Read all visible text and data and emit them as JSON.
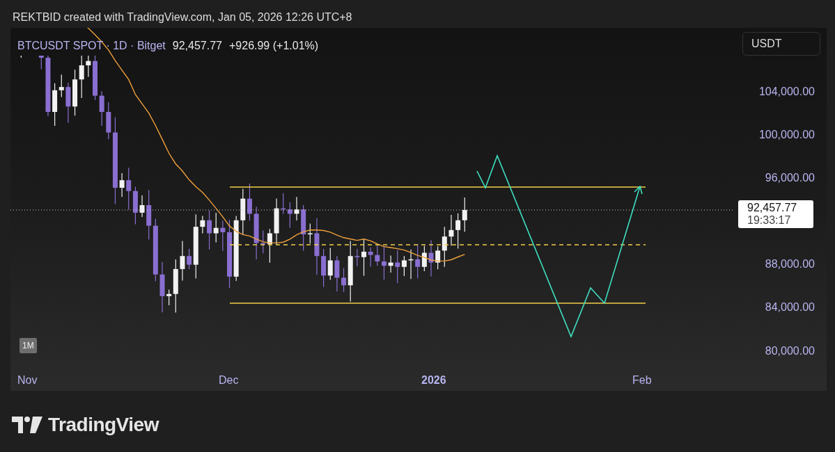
{
  "attribution": "REKTBID created with TradingView.com, Jan 05, 2026 12:26 UTC+8",
  "legend": {
    "symbol": "BTCUSDT SPOT · 1D · Bitget",
    "price": "92,457.77",
    "change": "+926.99 (+1.01%)"
  },
  "currency_button": "USDT",
  "price_axis": [
    "104,000.00",
    "100,000.00",
    "96,000.00",
    "88,000.00",
    "84,000.00",
    "80,000.00"
  ],
  "last_price": {
    "price": "92,457.77",
    "countdown": "19:33:17"
  },
  "range_button": "1M",
  "time_axis": [
    {
      "label": "Nov",
      "kind": "month"
    },
    {
      "label": "Dec",
      "kind": "month"
    },
    {
      "label": "2026",
      "kind": "year"
    },
    {
      "label": "Feb",
      "kind": "month"
    }
  ],
  "logo": "TradingView"
}
